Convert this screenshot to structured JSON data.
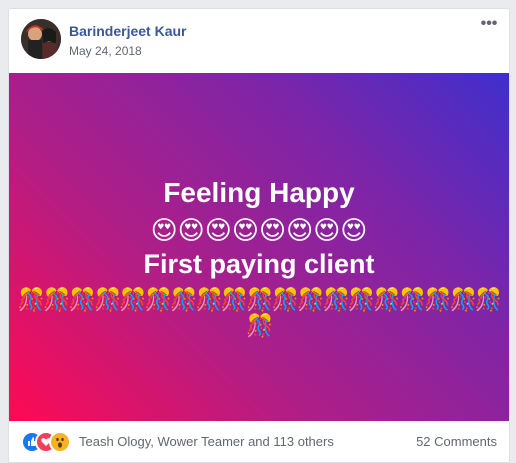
{
  "post": {
    "author": "Barinderjeet Kaur",
    "date": "May 24, 2018",
    "more_label": "•••"
  },
  "banner": {
    "line1": "Feeling Happy",
    "emoji_row1": "😍😍😍😍😍😍😍😍",
    "line2": "First paying client",
    "emoji_row2": "🎊🎊🎊🎊🎊🎊🎊🎊🎊🎊🎊🎊🎊🎊🎊🎊🎊🎊🎊🎊",
    "gradient_colors": [
      "#ff0a52",
      "#b01e86",
      "#7d25a8",
      "#3f2fcc"
    ]
  },
  "footer": {
    "reactions": [
      "like-icon",
      "love-icon",
      "wow-icon"
    ],
    "likers_text": "Teash Ology, Wower Teamer and 113 others",
    "comments_text": "52 Comments"
  }
}
